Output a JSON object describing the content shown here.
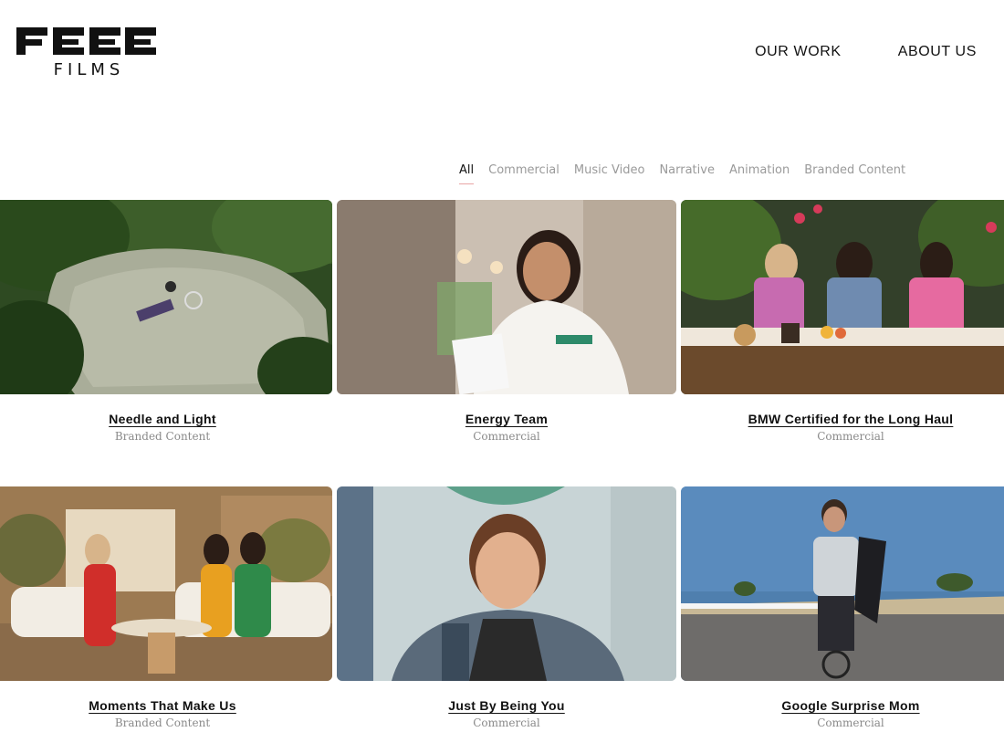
{
  "brand": {
    "logo_word": "FEEE",
    "logo_sub": "FILMS"
  },
  "nav": [
    {
      "label": "OUR WORK"
    },
    {
      "label": "ABOUT US"
    }
  ],
  "filters": [
    {
      "label": "All",
      "active": true
    },
    {
      "label": "Commercial"
    },
    {
      "label": "Music Video"
    },
    {
      "label": "Narrative"
    },
    {
      "label": "Animation"
    },
    {
      "label": "Branded Content"
    }
  ],
  "projects": [
    {
      "title": "Needle and Light",
      "category": "Branded Content"
    },
    {
      "title": "Energy Team",
      "category": "Commercial"
    },
    {
      "title": "BMW Certified for the Long Haul",
      "category": "Commercial"
    },
    {
      "title": "Moments That Make Us",
      "category": "Branded Content"
    },
    {
      "title": "Just By Being You",
      "category": "Commercial"
    },
    {
      "title": "Google Surprise Mom",
      "category": "Commercial"
    }
  ],
  "colors": {
    "accent_underline": "#e9a6a6",
    "muted_text": "#9a9a9a"
  }
}
